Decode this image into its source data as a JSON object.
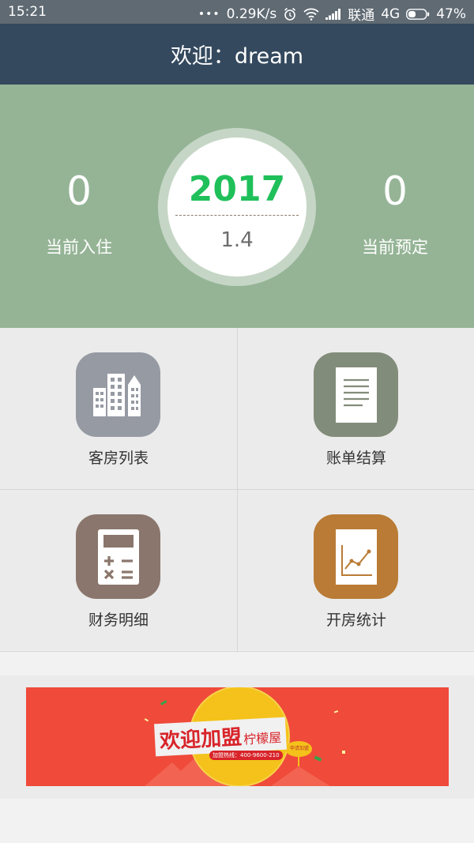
{
  "status_bar": {
    "time": "15:21",
    "speed": "0.29K/s",
    "carrier": "联通",
    "network": "4G",
    "battery": "47%"
  },
  "header": {
    "title": "欢迎：dream"
  },
  "summary": {
    "checked_in": {
      "value": "0",
      "label": "当前入住"
    },
    "reserved": {
      "value": "0",
      "label": "当前预定"
    },
    "date": {
      "year": "2017",
      "month_day": "1.4"
    }
  },
  "menu": [
    {
      "label": "客房列表",
      "icon": "building-icon",
      "color": "#969aa3"
    },
    {
      "label": "账单结算",
      "icon": "document-icon",
      "color": "#828c7a"
    },
    {
      "label": "财务明细",
      "icon": "calculator-icon",
      "color": "#8a766c"
    },
    {
      "label": "开房统计",
      "icon": "line-chart-icon",
      "color": "#b97b35"
    }
  ],
  "banner": {
    "headline": "欢迎加盟",
    "brand": "柠檬屋",
    "hotline": "加盟热线：400-9600-210",
    "cta": "申请加盟",
    "background": "#ef4a3a"
  }
}
